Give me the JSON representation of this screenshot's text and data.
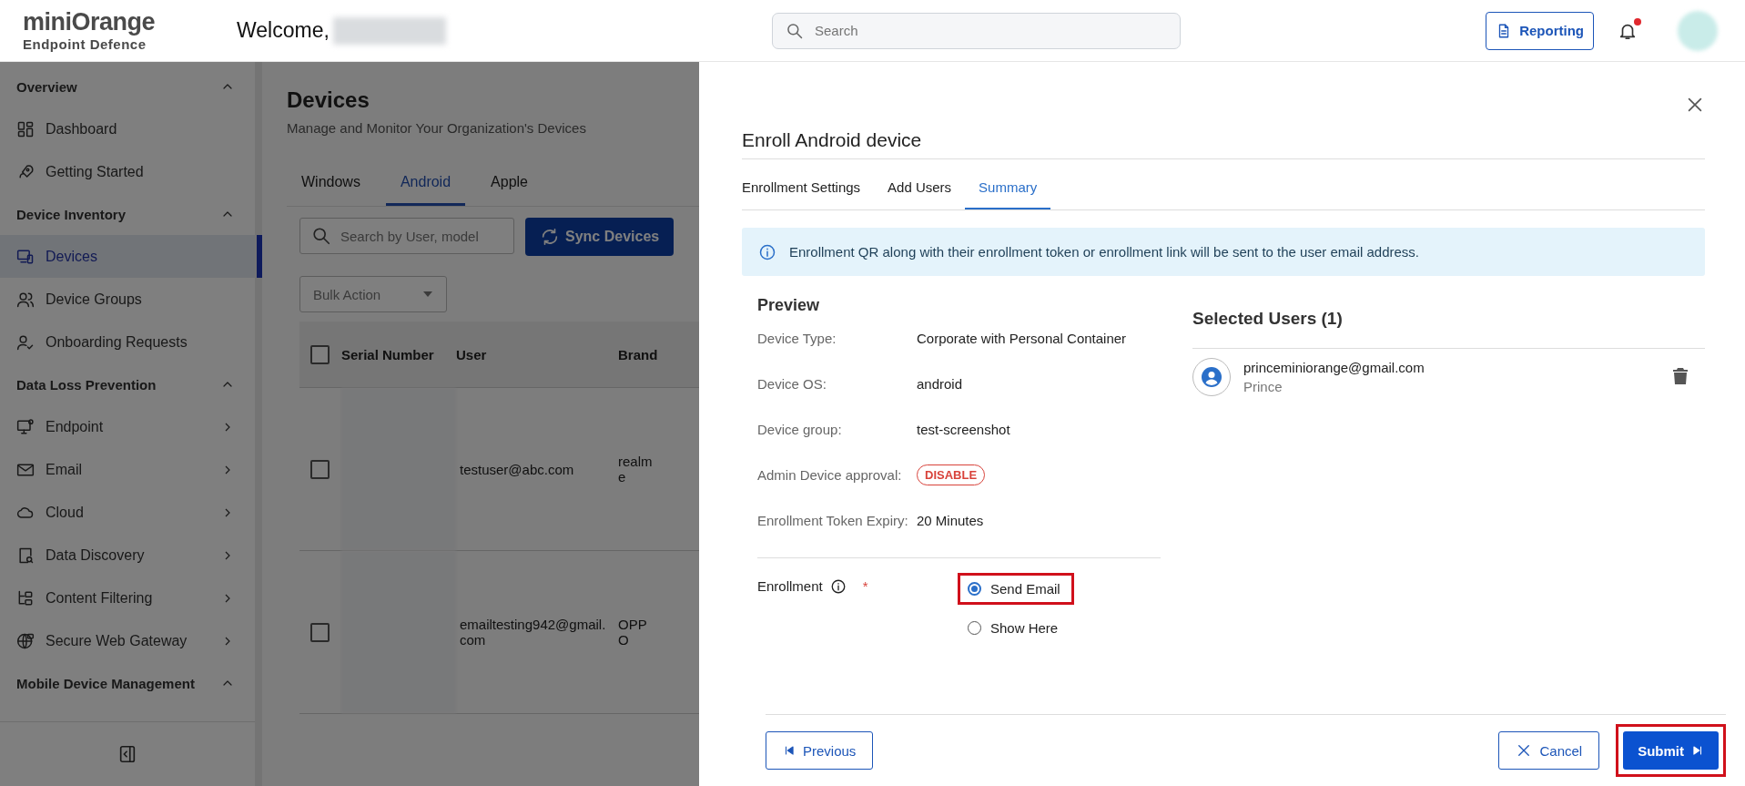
{
  "header": {
    "logo": "miniOrange",
    "logo_subtitle": "Endpoint Defence",
    "welcome": "Welcome,",
    "search": {
      "placeholder": "Search"
    },
    "reporting": "Reporting",
    "notifications_unread": true
  },
  "sidebar": {
    "sections": [
      {
        "title": "Overview",
        "expanded": true,
        "items": [
          {
            "label": "Dashboard",
            "selected": false,
            "submenu": false
          },
          {
            "label": "Getting Started",
            "selected": false,
            "submenu": false
          }
        ]
      },
      {
        "title": "Device Inventory",
        "expanded": true,
        "items": [
          {
            "label": "Devices",
            "selected": true,
            "submenu": false
          },
          {
            "label": "Device Groups",
            "selected": false,
            "submenu": false
          },
          {
            "label": "Onboarding Requests",
            "selected": false,
            "submenu": false
          }
        ]
      },
      {
        "title": "Data Loss Prevention",
        "expanded": true,
        "items": [
          {
            "label": "Endpoint",
            "selected": false,
            "submenu": true
          },
          {
            "label": "Email",
            "selected": false,
            "submenu": true
          },
          {
            "label": "Cloud",
            "selected": false,
            "submenu": true
          },
          {
            "label": "Data Discovery",
            "selected": false,
            "submenu": true
          },
          {
            "label": "Content Filtering",
            "selected": false,
            "submenu": true
          },
          {
            "label": "Secure Web Gateway",
            "selected": false,
            "submenu": true
          }
        ]
      },
      {
        "title": "Mobile Device Management",
        "expanded": true
      }
    ]
  },
  "devices": {
    "title": "Devices",
    "subtitle": "Manage and Monitor Your Organization's Devices",
    "tabs": [
      {
        "label": "Windows",
        "selected": false
      },
      {
        "label": "Android",
        "selected": true
      },
      {
        "label": "Apple",
        "selected": false
      }
    ],
    "search": {
      "placeholder": "Search by User, model"
    },
    "sync_button": "Sync Devices",
    "bulk_action": {
      "placeholder": "Bulk Action"
    },
    "table": {
      "all_checked": false,
      "columns": [
        "Serial Number",
        "User",
        "Brand"
      ],
      "rows": [
        {
          "checked": false,
          "user": "testuser@abc.com",
          "brand": "realme"
        },
        {
          "checked": false,
          "user": "emailtesting942@gmail.com",
          "brand": "OPPO"
        }
      ]
    }
  },
  "drawer": {
    "title": "Enroll Android device",
    "tabs": [
      {
        "label": "Enrollment Settings",
        "selected": false
      },
      {
        "label": "Add Users",
        "selected": false
      },
      {
        "label": "Summary",
        "selected": true
      }
    ],
    "info": "Enrollment QR along with their enrollment token or enrollment link will be sent to the user email address.",
    "preview": {
      "title": "Preview",
      "fields": [
        {
          "kind": "text",
          "label": "Device Type:",
          "value": "Corporate with Personal Container"
        },
        {
          "kind": "text",
          "label": "Device OS:",
          "value": "android"
        },
        {
          "kind": "text",
          "label": "Device group:",
          "value": "test-screenshot"
        },
        {
          "kind": "tag",
          "label": "Admin Device approval:",
          "value": "DISABLE"
        },
        {
          "kind": "text",
          "label": "Enrollment Token Expiry:",
          "value": "20 Minutes"
        }
      ]
    },
    "enrollment": {
      "label": "Enrollment",
      "required": true,
      "required_mark": "*",
      "options": [
        {
          "label": "Send Email",
          "selected": true,
          "highlighted": true
        },
        {
          "label": "Show Here",
          "selected": false,
          "highlighted": false
        }
      ]
    },
    "selected_users": {
      "title": "Selected Users (1)",
      "users": [
        {
          "email": "princeminiorange@gmail.com",
          "name": "Prince"
        }
      ]
    },
    "footer": {
      "previous": "Previous",
      "cancel": "Cancel",
      "submit": "Submit",
      "submit_highlighted": true
    }
  }
}
